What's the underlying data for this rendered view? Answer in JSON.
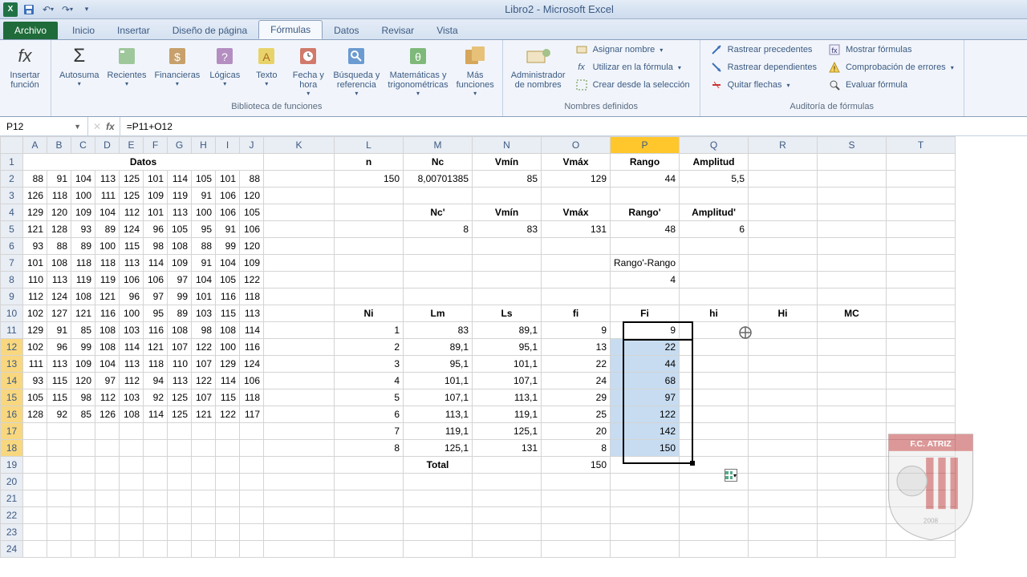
{
  "app": {
    "title": "Libro2 - Microsoft Excel"
  },
  "tabs": {
    "file": "Archivo",
    "items": [
      "Inicio",
      "Insertar",
      "Diseño de página",
      "Fórmulas",
      "Datos",
      "Revisar",
      "Vista"
    ],
    "active": 3
  },
  "ribbon": {
    "insertfn": {
      "label": "Insertar\nfunción"
    },
    "lib": {
      "autosuma": "Autosuma",
      "recientes": "Recientes",
      "financieras": "Financieras",
      "logicas": "Lógicas",
      "texto": "Texto",
      "fechahora": "Fecha y\nhora",
      "busqref": "Búsqueda y\nreferencia",
      "mattrig": "Matemáticas y\ntrigonométricas",
      "mas": "Más\nfunciones",
      "group": "Biblioteca de funciones"
    },
    "names": {
      "admin": "Administrador\nde nombres",
      "asignar": "Asignar nombre",
      "utilizar": "Utilizar en la fórmula",
      "crear": "Crear desde la selección",
      "group": "Nombres definidos"
    },
    "audit": {
      "prec": "Rastrear precedentes",
      "dep": "Rastrear dependientes",
      "quitar": "Quitar flechas",
      "mostrar": "Mostrar fórmulas",
      "comp": "Comprobación de errores",
      "eval": "Evaluar fórmula",
      "group": "Auditoría de fórmulas"
    }
  },
  "namebox": "P12",
  "formula": "=P11+O12",
  "columns": [
    "A",
    "B",
    "C",
    "D",
    "E",
    "F",
    "G",
    "H",
    "I",
    "J",
    "K",
    "L",
    "M",
    "N",
    "O",
    "P",
    "Q",
    "R",
    "S",
    "T"
  ],
  "datos_header": "Datos",
  "datos": [
    [
      88,
      91,
      104,
      113,
      125,
      101,
      114,
      105,
      101,
      88
    ],
    [
      126,
      118,
      100,
      111,
      125,
      109,
      119,
      91,
      106,
      120
    ],
    [
      129,
      120,
      109,
      104,
      112,
      101,
      113,
      100,
      106,
      105
    ],
    [
      121,
      128,
      93,
      89,
      124,
      96,
      105,
      95,
      91,
      106
    ],
    [
      93,
      88,
      89,
      100,
      115,
      98,
      108,
      88,
      99,
      120
    ],
    [
      101,
      108,
      118,
      118,
      113,
      114,
      109,
      91,
      104,
      109
    ],
    [
      110,
      113,
      119,
      119,
      106,
      106,
      97,
      104,
      105,
      122
    ],
    [
      112,
      124,
      108,
      121,
      96,
      97,
      99,
      101,
      116,
      118
    ],
    [
      102,
      127,
      121,
      116,
      100,
      95,
      89,
      103,
      115,
      113
    ],
    [
      129,
      91,
      85,
      108,
      103,
      116,
      108,
      98,
      108,
      114
    ],
    [
      102,
      96,
      99,
      108,
      114,
      121,
      107,
      122,
      100,
      116
    ],
    [
      111,
      113,
      109,
      104,
      113,
      118,
      110,
      107,
      129,
      124
    ],
    [
      93,
      115,
      120,
      97,
      112,
      94,
      113,
      122,
      114,
      106
    ],
    [
      105,
      115,
      98,
      112,
      103,
      92,
      125,
      107,
      115,
      118
    ],
    [
      128,
      92,
      85,
      126,
      108,
      114,
      125,
      121,
      122,
      117
    ]
  ],
  "stats_top": {
    "headers": [
      "n",
      "Nc",
      "Vmín",
      "Vmáx",
      "Rango",
      "Amplitud"
    ],
    "values": [
      "150",
      "8,00701385",
      "85",
      "129",
      "44",
      "5,5"
    ]
  },
  "stats_prime": {
    "headers": [
      "Nc'",
      "Vmín",
      "Vmáx",
      "Rango'",
      "Amplitud'"
    ],
    "values": [
      "8",
      "83",
      "131",
      "48",
      "6"
    ]
  },
  "rango_label": "Rango'-Rango",
  "rango_value": "4",
  "table": {
    "headers": [
      "Ni",
      "Lm",
      "Ls",
      "fi",
      "Fi",
      "hi",
      "Hi",
      "MC"
    ],
    "rows": [
      [
        "1",
        "83",
        "89,1",
        "9",
        "9"
      ],
      [
        "2",
        "89,1",
        "95,1",
        "13",
        "22"
      ],
      [
        "3",
        "95,1",
        "101,1",
        "22",
        "44"
      ],
      [
        "4",
        "101,1",
        "107,1",
        "24",
        "68"
      ],
      [
        "5",
        "107,1",
        "113,1",
        "29",
        "97"
      ],
      [
        "6",
        "113,1",
        "119,1",
        "25",
        "122"
      ],
      [
        "7",
        "119,1",
        "125,1",
        "20",
        "142"
      ],
      [
        "8",
        "125,1",
        "131",
        "8",
        "150"
      ]
    ],
    "total_label": "Total",
    "total_fi": "150"
  }
}
